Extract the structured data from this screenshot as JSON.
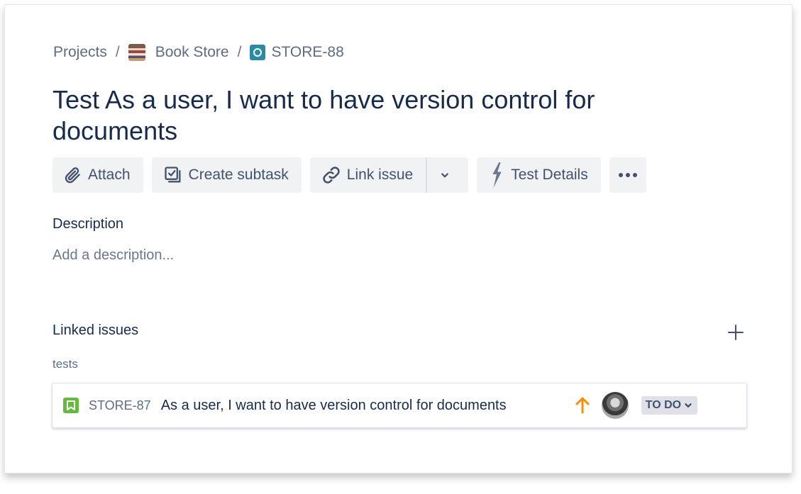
{
  "breadcrumb": {
    "projects": "Projects",
    "separator": "/",
    "project_name": "Book Store",
    "issue_key": "STORE-88"
  },
  "issue": {
    "title": "Test As a user, I want to have version control for documents"
  },
  "toolbar": {
    "attach": "Attach",
    "create_subtask": "Create subtask",
    "link_issue": "Link issue",
    "test_details": "Test Details"
  },
  "description": {
    "heading": "Description",
    "placeholder": "Add a description..."
  },
  "linked_issues": {
    "heading": "Linked issues",
    "link_type": "tests",
    "items": [
      {
        "key": "STORE-87",
        "summary": "As a user, I want to have version control for documents",
        "status": "TO DO",
        "priority_icon": "arrow-up-icon",
        "type_icon": "story-icon"
      }
    ]
  },
  "colors": {
    "title": "#172b4d",
    "story": "#63ba3c",
    "priority_high": "#ff8b00",
    "button_bg": "#f1f2f4"
  }
}
